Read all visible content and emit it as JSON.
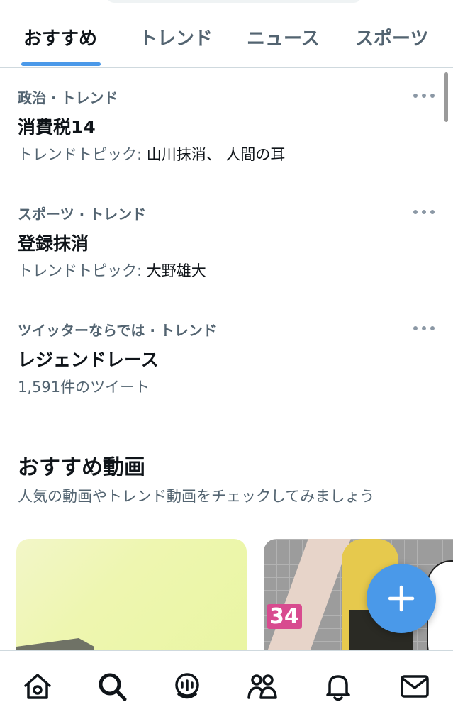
{
  "tabs": [
    {
      "label": "おすすめ",
      "active": true
    },
    {
      "label": "トレンド",
      "active": false
    },
    {
      "label": "ニュース",
      "active": false
    },
    {
      "label": "スポーツ",
      "active": false
    }
  ],
  "trends": [
    {
      "meta": "政治 · トレンド",
      "title": "消費税14",
      "sub_prefix": "トレンドトピック: ",
      "sub_value": "山川抹消、 人間の耳"
    },
    {
      "meta": "スポーツ · トレンド",
      "title": "登録抹消",
      "sub_prefix": "トレンドトピック: ",
      "sub_value": "大野雄大"
    },
    {
      "meta": "ツイッターならでは · トレンド",
      "title": "レジェンドレース",
      "sub_prefix": "1,591件のツイート",
      "sub_value": ""
    }
  ],
  "videos_section": {
    "title": "おすすめ動画",
    "subtitle": "人気の動画やトレンド動画をチェックしてみましょう",
    "card2_badge": "34"
  },
  "icons": {
    "more": "more-horizontal-icon",
    "fab": "plus-icon",
    "nav": [
      "home-icon",
      "search-icon",
      "spaces-icon",
      "communities-icon",
      "notifications-icon",
      "messages-icon"
    ]
  },
  "colors": {
    "accent": "#4a99e9",
    "text_primary": "#0f1419",
    "text_secondary": "#536471"
  }
}
